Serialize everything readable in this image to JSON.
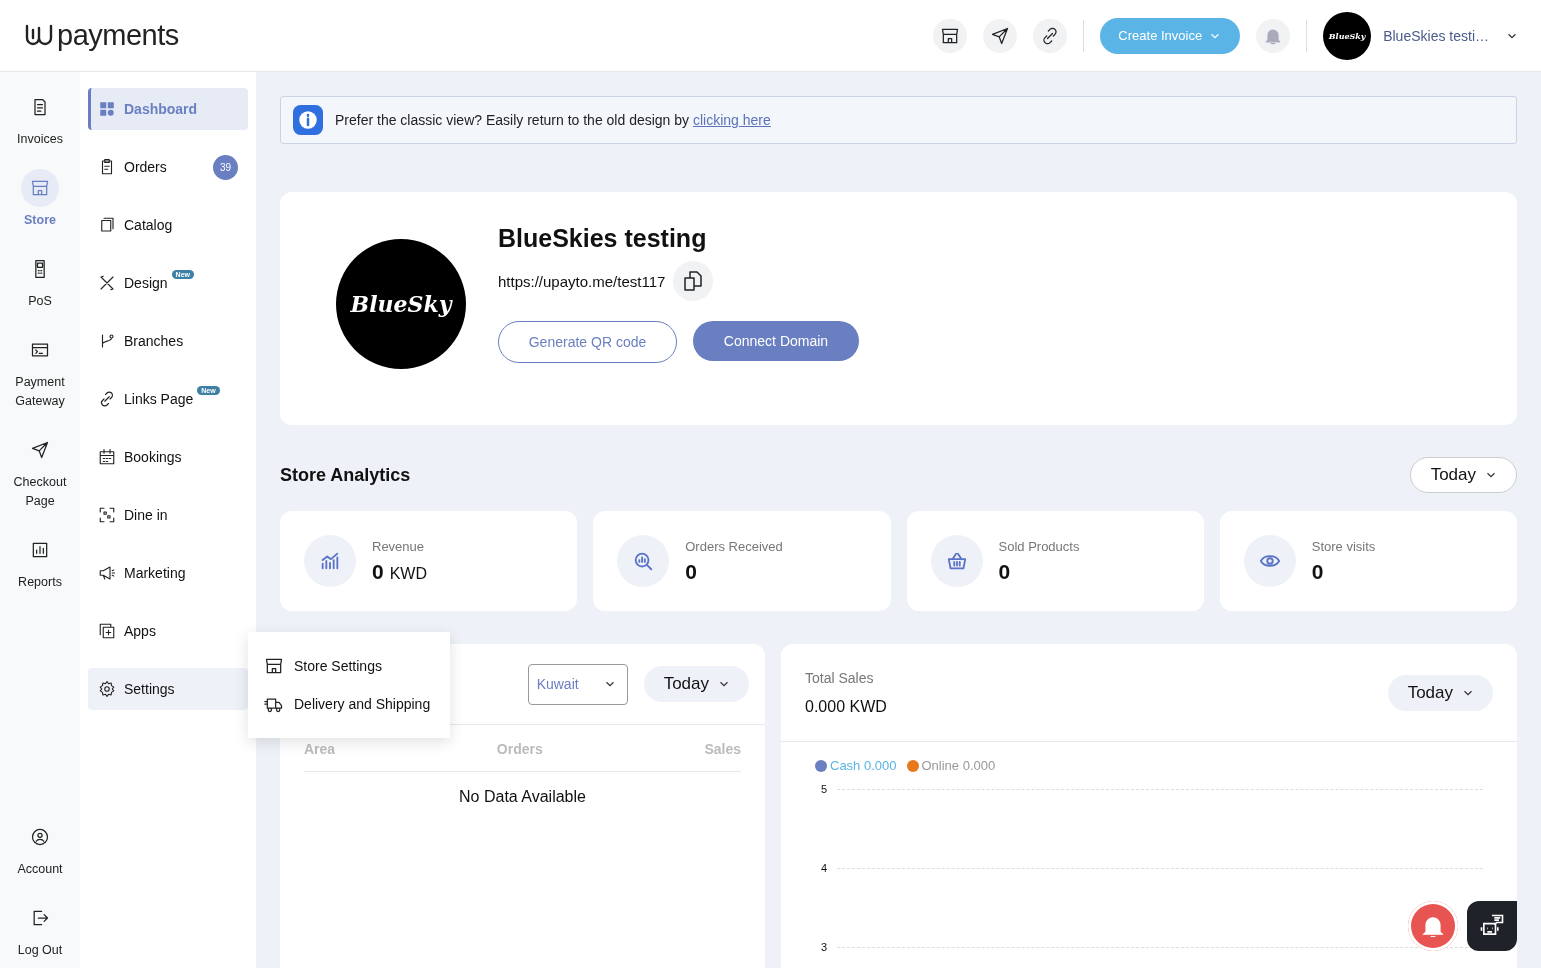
{
  "header": {
    "logo_text": "payments",
    "create_button": "Create Invoice",
    "account_avatar": "BlueSky",
    "account_name": "BlueSkies testi…"
  },
  "rail": {
    "items": [
      {
        "label": "Invoices",
        "selected": false
      },
      {
        "label": "Store",
        "selected": true
      },
      {
        "label": "PoS",
        "selected": false
      },
      {
        "label": "Payment Gateway",
        "selected": false
      },
      {
        "label": "Checkout Page",
        "selected": false
      },
      {
        "label": "Reports",
        "selected": false
      }
    ],
    "bottom_items": [
      {
        "label": "Account"
      },
      {
        "label": "Log Out"
      }
    ]
  },
  "menu": {
    "items": [
      {
        "label": "Dashboard",
        "selected": true,
        "expanded": false
      },
      {
        "label": "Orders",
        "selected": false,
        "expanded": false,
        "count": "39"
      },
      {
        "label": "Catalog",
        "selected": false,
        "expanded": false
      },
      {
        "label": "Design",
        "selected": false,
        "expanded": false,
        "tag": "New"
      },
      {
        "label": "Branches",
        "selected": false,
        "expanded": false
      },
      {
        "label": "Links Page",
        "selected": false,
        "expanded": false,
        "tag": "New"
      },
      {
        "label": "Bookings",
        "selected": false,
        "expanded": false
      },
      {
        "label": "Dine in",
        "selected": false,
        "expanded": false
      },
      {
        "label": "Marketing",
        "selected": false,
        "expanded": false
      },
      {
        "label": "Apps",
        "selected": false,
        "expanded": false
      },
      {
        "label": "Settings",
        "selected": false,
        "expanded": true
      }
    ]
  },
  "settings_popup": {
    "items": [
      "Store Settings",
      "Delivery and Shipping"
    ]
  },
  "banner": {
    "text": "Prefer the classic view? Easily return to the old design by ",
    "link": "clicking here"
  },
  "store": {
    "logo_text": "BlueSky",
    "name": "BlueSkies testing",
    "url": "https://upayto.me/test117",
    "qr_button": "Generate QR code",
    "domain_button": "Connect Domain"
  },
  "analytics": {
    "title": "Store Analytics",
    "period": "Today",
    "stats": [
      {
        "label": "Revenue",
        "value": "0",
        "unit": "KWD"
      },
      {
        "label": "Orders Received",
        "value": "0"
      },
      {
        "label": "Sold Products",
        "value": "0"
      },
      {
        "label": "Store visits",
        "value": "0"
      }
    ]
  },
  "area_card": {
    "country": "Kuwait",
    "period": "Today",
    "columns": [
      "Area",
      "Orders",
      "Sales"
    ],
    "empty_text": "No Data Available"
  },
  "sales_card": {
    "title": "Total Sales",
    "total": "0.000 KWD",
    "period": "Today",
    "legend": [
      {
        "label": "Cash 0.000",
        "color": "#6a7fc1"
      },
      {
        "label": "Online 0.000",
        "color": "#e8791b"
      }
    ],
    "y_labels": [
      "5",
      "4",
      "3"
    ]
  }
}
